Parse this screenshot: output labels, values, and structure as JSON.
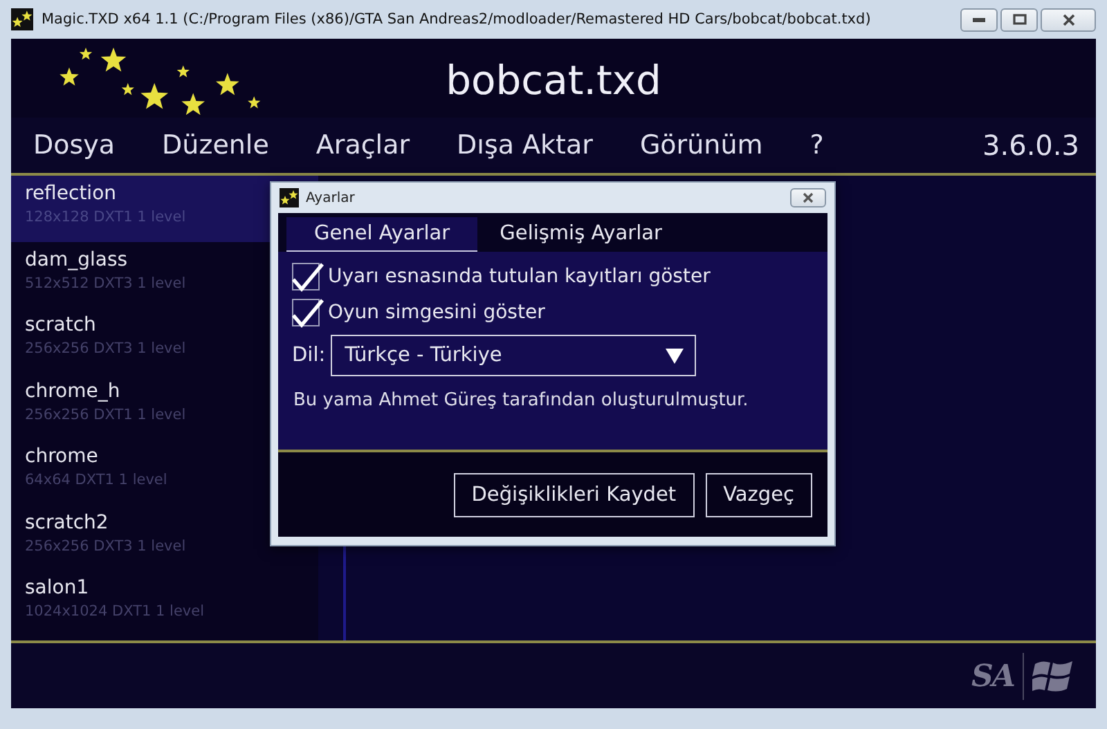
{
  "window": {
    "title": "Magic.TXD x64 1.1 (C:/Program Files (x86)/GTA San Andreas2/modloader/Remastered HD Cars/bobcat/bobcat.txd)"
  },
  "header": {
    "title": "bobcat.txd"
  },
  "menu": {
    "items": [
      "Dosya",
      "Düzenle",
      "Araçlar",
      "Dışa Aktar",
      "Görünüm",
      "?"
    ],
    "version": "3.6.0.3"
  },
  "textures": [
    {
      "name": "reflection",
      "info": "128x128 DXT1 1 level",
      "selected": true
    },
    {
      "name": "dam_glass",
      "info": "512x512 DXT3 1 level",
      "selected": false
    },
    {
      "name": "scratch",
      "info": "256x256 DXT3 1 level",
      "selected": false
    },
    {
      "name": "chrome_h",
      "info": "256x256 DXT1 1 level",
      "selected": false
    },
    {
      "name": "chrome",
      "info": "64x64 DXT1 1 level",
      "selected": false
    },
    {
      "name": "scratch2",
      "info": "256x256 DXT3 1 level",
      "selected": false
    },
    {
      "name": "salon1",
      "info": "1024x1024 DXT1 1 level",
      "selected": false
    }
  ],
  "dialog": {
    "title": "Ayarlar",
    "tabs": [
      {
        "label": "Genel Ayarlar",
        "selected": true
      },
      {
        "label": "Gelişmiş Ayarlar",
        "selected": false
      }
    ],
    "options": [
      {
        "label": "Uyarı esnasında tutulan kayıtları göster",
        "checked": true
      },
      {
        "label": "Oyun simgesini göster",
        "checked": true
      }
    ],
    "language": {
      "label": "Dil:",
      "value": "Türkçe - Türkiye"
    },
    "note": "Bu yama Ahmet Güreş tarafından oluşturulmuştur.",
    "buttons": [
      "Değişiklikleri Kaydet",
      "Vazgeç"
    ]
  },
  "footer": {
    "logo": "SA"
  }
}
